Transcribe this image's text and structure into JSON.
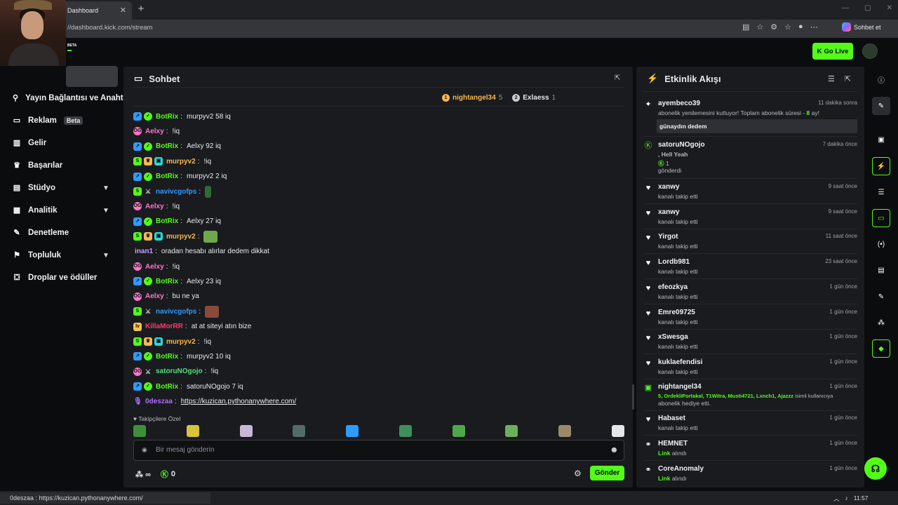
{
  "browser": {
    "tab_title": "Dashboard",
    "tab_close": "✕",
    "new_tab": "+",
    "url": "//dashboard.kick.com/stream",
    "chat_button": "Sohbet et",
    "window_controls": [
      "—",
      "▢",
      "✕"
    ]
  },
  "header": {
    "beta_label": "BETA",
    "go_live": "Go Live"
  },
  "sidebar": {
    "items": [
      {
        "label": "Yayın Bağlantısı ve Anahtarı",
        "icon": "link-icon",
        "glyph": "⚲"
      },
      {
        "label": "Reklam",
        "badge": "Beta",
        "icon": "ad-icon",
        "glyph": "▭"
      },
      {
        "label": "Gelir",
        "icon": "chart-icon",
        "glyph": "▥"
      },
      {
        "label": "Başarılar",
        "icon": "trophy-icon",
        "glyph": "♛"
      },
      {
        "label": "Stüdyo",
        "icon": "studio-icon",
        "glyph": "▤",
        "expandable": true
      },
      {
        "label": "Analitik",
        "icon": "analytics-icon",
        "glyph": "▦",
        "expandable": true
      },
      {
        "label": "Denetleme",
        "icon": "wrench-icon",
        "glyph": "✎"
      },
      {
        "label": "Topluluk",
        "icon": "community-icon",
        "glyph": "⚑",
        "expandable": true
      },
      {
        "label": "Droplar ve ödüller",
        "icon": "gift-icon",
        "glyph": "⛋"
      }
    ]
  },
  "chat": {
    "title": "Sohbet",
    "leaderboard": [
      {
        "rank": "1",
        "name": "nightangel34",
        "count": "5",
        "color": "#f8b84e"
      },
      {
        "rank": "2",
        "name": "Exlaess",
        "count": "1",
        "color": "#c9ccd1"
      }
    ],
    "messages": [
      {
        "badges": [
          "bot",
          "ver"
        ],
        "user": "BotRix",
        "color": "#53fc18",
        "text": "murpyv2 58 iq"
      },
      {
        "badges": [
          "og"
        ],
        "user": "Aelxy",
        "color": "#ff76c9",
        "text": "!iq"
      },
      {
        "badges": [
          "bot",
          "ver"
        ],
        "user": "BotRix",
        "color": "#53fc18",
        "text": "Aelxy 92 iq"
      },
      {
        "badges": [
          "sub",
          "crown",
          "tv"
        ],
        "user": "murpyv2",
        "color": "#f8b84e",
        "text": "!iq"
      },
      {
        "badges": [
          "bot",
          "ver"
        ],
        "user": "BotRix",
        "color": "#53fc18",
        "text": "murpyv2 2 iq"
      },
      {
        "badges": [
          "sub",
          "sword"
        ],
        "user": "navivcgofps",
        "color": "#2f9bff",
        "text": "",
        "emote": "#2e6b34",
        "emote_w": 9
      },
      {
        "badges": [
          "og"
        ],
        "user": "Aelxy",
        "color": "#ff76c9",
        "text": "!iq"
      },
      {
        "badges": [
          "bot",
          "ver"
        ],
        "user": "BotRix",
        "color": "#53fc18",
        "text": "Aelxy 27 iq"
      },
      {
        "badges": [
          "sub",
          "crown",
          "tv"
        ],
        "user": "murpyv2",
        "color": "#f8b84e",
        "text": "",
        "emote": "#6fa84a",
        "emote_w": 20
      },
      {
        "badges": [],
        "user": "inan1",
        "color": "#c9a0ff",
        "text": "oradan hesabı alırlar dedem dikkat"
      },
      {
        "badges": [
          "og"
        ],
        "user": "Aelxy",
        "color": "#ff76c9",
        "text": "!iq"
      },
      {
        "badges": [
          "bot",
          "ver"
        ],
        "user": "BotRix",
        "color": "#53fc18",
        "text": "Aelxy 23 iq"
      },
      {
        "badges": [
          "og"
        ],
        "user": "Aelxy",
        "color": "#ff76c9",
        "text": "bu ne ya"
      },
      {
        "badges": [
          "sub",
          "sword"
        ],
        "user": "navivcgofps",
        "color": "#2f9bff",
        "text": "",
        "emote": "#8a4a3a",
        "emote_w": 20
      },
      {
        "badges": [
          "lvl"
        ],
        "user": "KillaMorRR",
        "color": "#ff3b6b",
        "text": "at at siteyi atın bize"
      },
      {
        "badges": [
          "sub",
          "crown",
          "tv"
        ],
        "user": "murpyv2",
        "color": "#f8b84e",
        "text": "!iq"
      },
      {
        "badges": [
          "bot",
          "ver"
        ],
        "user": "BotRix",
        "color": "#53fc18",
        "text": "murpyv2 10 iq"
      },
      {
        "badges": [
          "og",
          "sword"
        ],
        "user": "satoruNOgojo",
        "color": "#53e07c",
        "text": "!iq"
      },
      {
        "badges": [
          "bot",
          "ver"
        ],
        "user": "BotRix",
        "color": "#53fc18",
        "text": "satoruNOgojo 7 iq"
      },
      {
        "badges": [
          "mic"
        ],
        "user": "0deszaa",
        "color": "#b36bff",
        "text": "",
        "link": "https://kuzican.pythonanywhere.com/"
      }
    ],
    "followers_only": "♥ Takipçilere Özel",
    "emote_colors": [
      "#3f8f3a",
      "#d9c33a",
      "#c8b8d8",
      "#556a6a",
      "#2f9bff",
      "#3f8f5a",
      "#4ea84a",
      "#6ab05a",
      "#9a8a6a",
      "#e6e6e6"
    ],
    "input_placeholder": "Bir mesaj gönderin",
    "points": "0",
    "infinity": "∞",
    "send": "Gönder"
  },
  "activity": {
    "title": "Etkinlik Akışı",
    "events": [
      {
        "icon": "gift-icon",
        "glyph": "✦",
        "name": "ayembeco39",
        "time": "11 dakika sonra",
        "desc": "abonelik yenilemesini kutluyor! Toplam abonelik süresi - ",
        "desc_green": "8",
        "desc_tail": " ay!",
        "message": "günaydın dedem"
      },
      {
        "icon": "kick-icon",
        "glyph": "Ⓚ",
        "name": "satoruNOgojo",
        "time": "7 dakika önce",
        "line1": ", Hell Yeah",
        "line2": "1",
        "line3": "gönderdi"
      },
      {
        "icon": "heart-icon",
        "glyph": "♥",
        "name": "xanwy",
        "time": "9 saat önce",
        "desc": "kanalı takip etti"
      },
      {
        "icon": "heart-icon",
        "glyph": "♥",
        "name": "xanwy",
        "time": "9 saat önce",
        "desc": "kanalı takip etti"
      },
      {
        "icon": "heart-icon",
        "glyph": "♥",
        "name": "Yirgot",
        "time": "11 saat önce",
        "desc": "kanalı takip etti"
      },
      {
        "icon": "heart-icon",
        "glyph": "♥",
        "name": "Lordb981",
        "time": "23 saat önce",
        "desc": "kanalı takip etti"
      },
      {
        "icon": "heart-icon",
        "glyph": "♥",
        "name": "efeozkya",
        "time": "1 gün önce",
        "desc": "kanalı takip etti"
      },
      {
        "icon": "heart-icon",
        "glyph": "♥",
        "name": "Emre09725",
        "time": "1 gün önce",
        "desc": "kanalı takip etti"
      },
      {
        "icon": "heart-icon",
        "glyph": "♥",
        "name": "xSwesga",
        "time": "1 gün önce",
        "desc": "kanalı takip etti"
      },
      {
        "icon": "heart-icon",
        "glyph": "♥",
        "name": "kuklaefendisi",
        "time": "1 gün önce",
        "desc": "kanalı takip etti"
      },
      {
        "icon": "gift-sub-icon",
        "glyph": "▣",
        "name": "nightangel34",
        "time": "1 gün önce",
        "green_line": "5, OrdekliPortakal, T1Witra, Musti4721, Lxnch1, Ajazzz",
        "green_tail": " isimli kullanıcıya",
        "line_b": "abonelik hediye etti."
      },
      {
        "icon": "heart-icon",
        "glyph": "♥",
        "name": "Habaset",
        "time": "1 gün önce",
        "desc": "kanalı takip etti"
      },
      {
        "icon": "link-icon",
        "glyph": "⚭",
        "name": "HEMNET",
        "time": "1 gün önce",
        "green": "Link",
        "desc_tail": " alındı"
      },
      {
        "icon": "link-icon",
        "glyph": "⚭",
        "name": "CoreAnomaly",
        "time": "1 gün önce",
        "green": "Link",
        "desc_tail": " alındı"
      }
    ]
  },
  "status_bar": {
    "user": "0deszaa",
    "sep": " : ",
    "link": "https://kuzican.pythonanywhere.com/"
  },
  "tray": {
    "time": "11:57"
  }
}
